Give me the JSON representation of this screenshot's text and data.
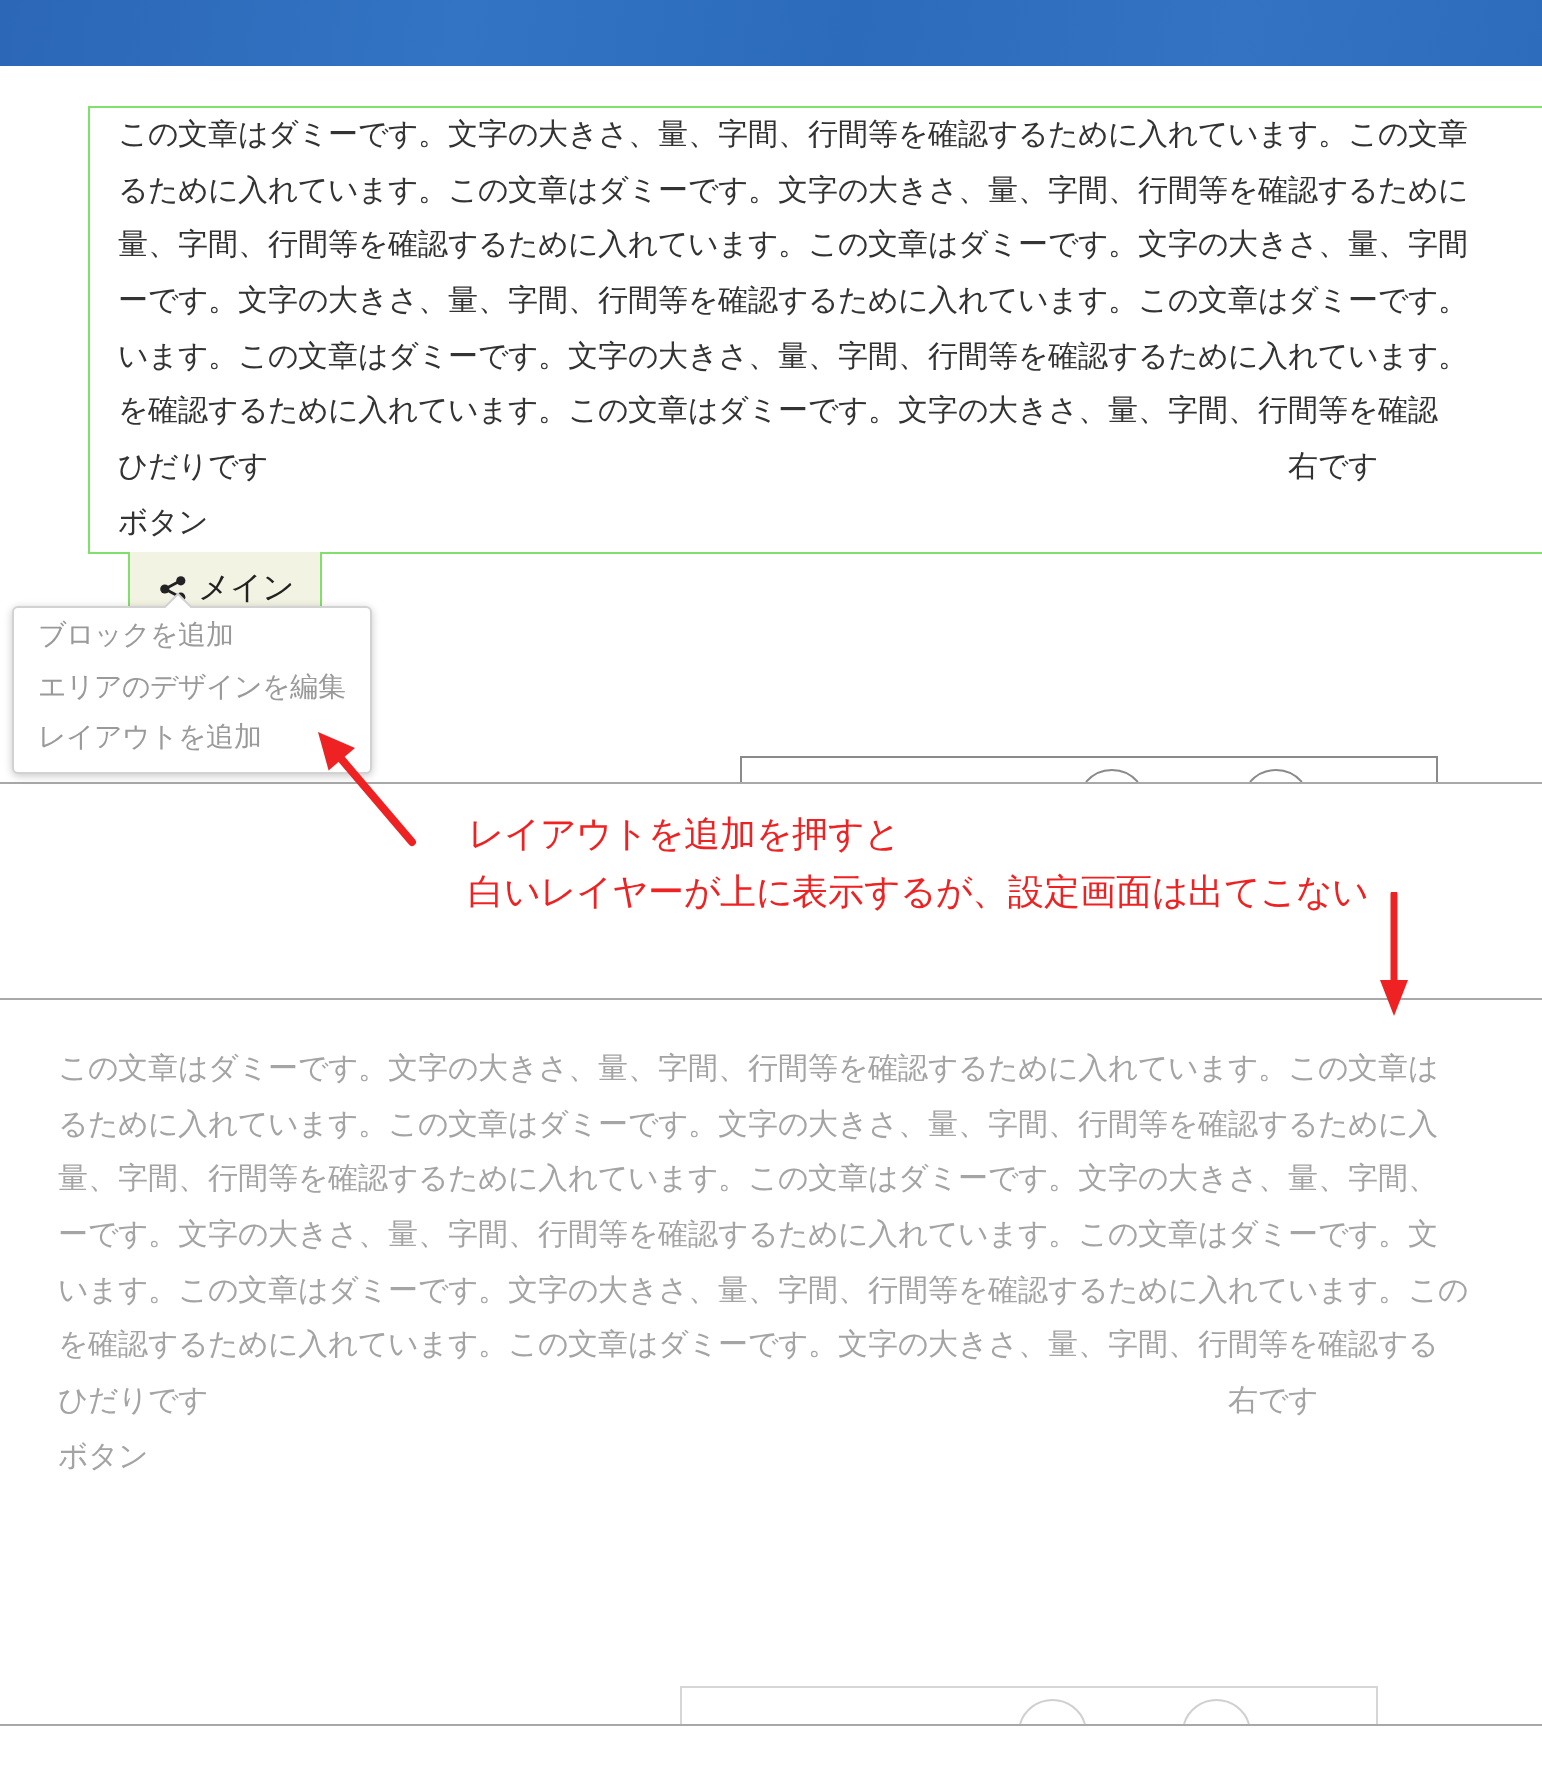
{
  "editor_view": {
    "content_block": {
      "outlined": true,
      "lines": [
        "この文章はダミーです。文字の大きさ、量、字間、行間等を確認するために入れています。この文章",
        "るために入れています。この文章はダミーです。文字の大きさ、量、字間、行間等を確認するために",
        "量、字間、行間等を確認するために入れています。この文章はダミーです。文字の大きさ、量、字間",
        "ーです。文字の大きさ、量、字間、行間等を確認するために入れています。この文章はダミーです。",
        "います。この文章はダミーです。文字の大きさ、量、字間、行間等を確認するために入れています。",
        "を確認するために入れています。この文章はダミーです。文字の大きさ、量、字間、行間等を確認"
      ],
      "left_text": "ひだりです",
      "right_text": "右です",
      "caption": "ボタン"
    },
    "area_tab": {
      "label": "メイン"
    },
    "context_menu": {
      "items": [
        {
          "label": "ブロックを追加"
        },
        {
          "label": "エリアのデザインを編集"
        },
        {
          "label": "レイアウトを追加"
        }
      ]
    }
  },
  "annotation": {
    "lines": [
      "レイアウトを追加を押すと",
      "白いレイヤーが上に表示するが、設定画面は出てこない"
    ]
  },
  "overlay_view": {
    "dimmed": true,
    "content_block": {
      "lines": [
        "この文章はダミーです。文字の大きさ、量、字間、行間等を確認するために入れています。この文章は",
        "るために入れています。この文章はダミーです。文字の大きさ、量、字間、行間等を確認するために入",
        "量、字間、行間等を確認するために入れています。この文章はダミーです。文字の大きさ、量、字間、",
        "ーです。文字の大きさ、量、字間、行間等を確認するために入れています。この文章はダミーです。文",
        "います。この文章はダミーです。文字の大きさ、量、字間、行間等を確認するために入れています。この",
        "を確認するために入れています。この文章はダミーです。文字の大きさ、量、字間、行間等を確認する"
      ],
      "left_text": "ひだりです",
      "right_text": "右です",
      "caption": "ボタン"
    }
  }
}
